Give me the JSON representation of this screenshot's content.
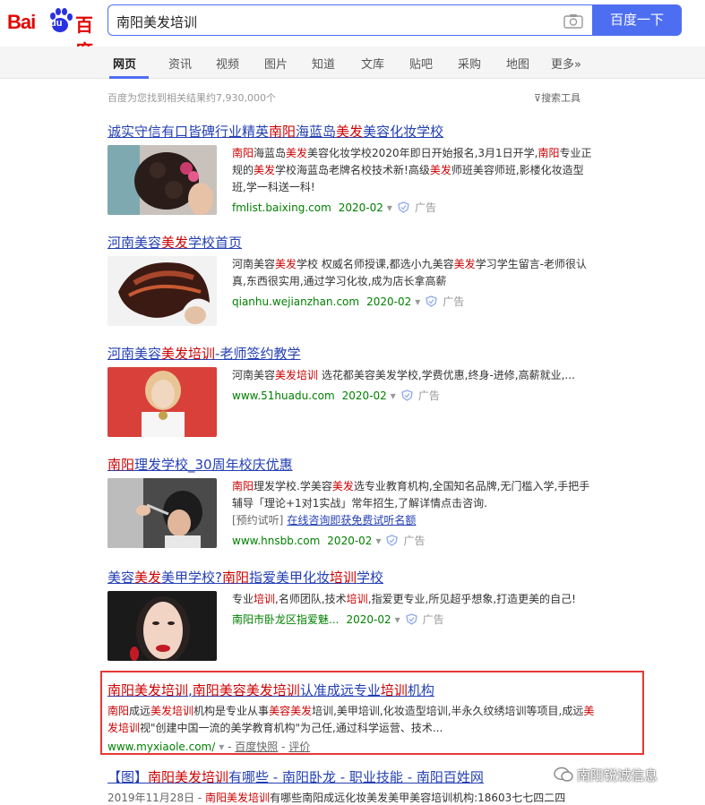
{
  "logo": {
    "left": "Bai",
    "mid": "du",
    "right": "百度"
  },
  "search": {
    "query": "南阳美发培训",
    "button": "百度一下"
  },
  "tabs": [
    "网页",
    "资讯",
    "视频",
    "图片",
    "知道",
    "文库",
    "贴吧",
    "采购",
    "地图",
    "更多»"
  ],
  "stats": "百度为您找到相关结果约7,930,000个",
  "tools": "搜索工具",
  "results": [
    {
      "title": [
        "诚实守信有口皆碑行业精英",
        "南阳",
        "海蓝岛",
        "美发",
        "美容化妆学校"
      ],
      "abstract": [
        "南阳",
        "海蓝岛",
        "美发",
        "美容化妆学校2020年即日开始报名,3月1日开学,",
        "南阳",
        "专业正规的",
        "美发",
        "学校海蓝岛老牌名校技术新!高级",
        "美发",
        "师班美容师班,影楼化妆造型班,学一科送一科!"
      ],
      "url": "fmlist.baixing.com",
      "date": "2020-02",
      "ad": "广告"
    },
    {
      "title": [
        "河南美容",
        "美发",
        "学校首页"
      ],
      "abstract": [
        "河南美容",
        "美发",
        "学校 权威名师授课,都选小九美容",
        "美发",
        "学习学生留言-老师很认真,东西很实用,通过学习化妆,成为店长拿高薪"
      ],
      "url": "qianhu.wejianzhan.com",
      "date": "2020-02",
      "ad": "广告"
    },
    {
      "title": [
        "河南美容",
        "美发培训",
        "-老师签约教学"
      ],
      "abstract": [
        "河南美容",
        "美发培训",
        " 选花都美容美发学校,学费优惠,终身-进修,高薪就业,..."
      ],
      "url": "www.51huadu.com",
      "date": "2020-02",
      "ad": "广告"
    },
    {
      "title": [
        "南阳",
        "理发学校_30周年校庆优惠"
      ],
      "abstract": [
        "南阳",
        "理发学校.学美容",
        "美发",
        "选专业教育机构,全国知名品牌,无门槛入学,手把手辅导「理论+1对1实战」常年招生,了解详情点击咨询."
      ],
      "sub_label": "[预约试听]",
      "sub_link": "在线咨询即获免费试听名额",
      "url": "www.hnsbb.com",
      "date": "2020-02",
      "ad": "广告"
    },
    {
      "title": [
        "美容",
        "美发",
        "美甲学校?",
        "南阳",
        "指爱美甲化妆",
        "培训",
        "学校"
      ],
      "abstract": [
        "专业",
        "培训",
        ",名师团队,技术",
        "培训",
        ",指爱更专业,所见超乎想象,打造更美的自己!"
      ],
      "url": "南阳市卧龙区指爱魅...",
      "date": "2020-02",
      "ad": "广告"
    }
  ],
  "organic": {
    "title": [
      "南阳美发培训",
      ",",
      "南阳美容美发培训",
      "认准成远专业",
      "培训",
      "机构"
    ],
    "abstract": [
      "南阳",
      "成远",
      "美发培训",
      "机构是专业从事",
      "美容美发",
      "培训,美甲培训,化妆造型培训,半永久纹绣培训等项目,成远",
      "美发培训",
      "视\"创建中国一流的美学教育机构\"为己任,通过科学运营、技术..."
    ],
    "url": "www.myxiaole.com/",
    "cache": "百度快照",
    "review": "评价"
  },
  "next": {
    "title": [
      "【图】",
      "南阳美发培训",
      "有哪些 - 南阳卧龙 - 职业技能 - 南阳百姓网"
    ],
    "abstract": [
      "2019年11月28日 - ",
      "南阳美发培训",
      "有哪些南阳成远化妆美发美甲美容培训机构:18603七七四二四"
    ]
  },
  "watermark": "南阳锐诚信息",
  "colors": {
    "brand_red": "#e10602",
    "brand_blue": "#4e6ef2",
    "link": "#2440b3",
    "highlight": "#cc0000",
    "url_green": "#008000",
    "frame_red": "#e53935"
  }
}
